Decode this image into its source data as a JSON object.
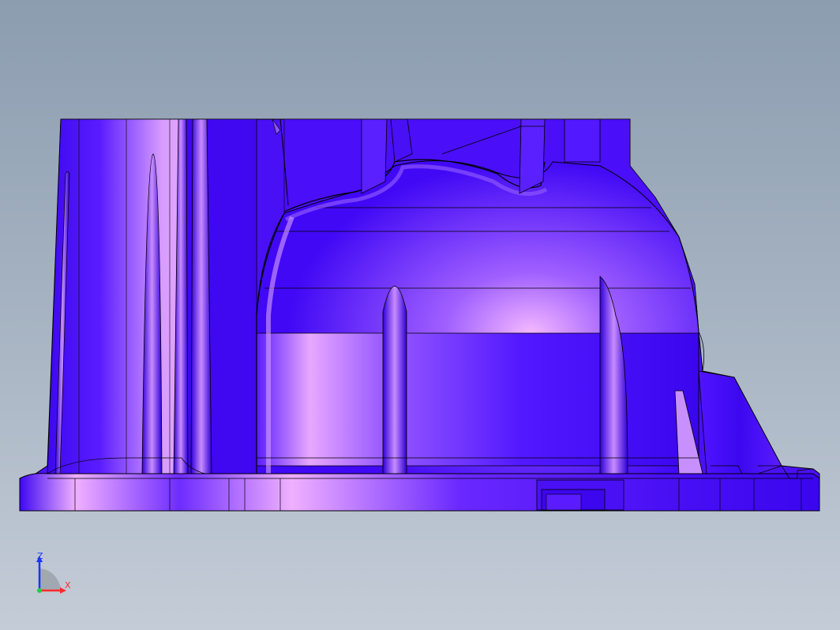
{
  "viewport": {
    "background_top": "#8c9db0",
    "background_bottom": "#c4ccd7",
    "part_color": "#4a10f5",
    "highlight_color": "#f0a8ff",
    "edge_color": "#000000"
  },
  "triad": {
    "z_label": "Z",
    "x_label": "X",
    "z_color": "#1a35ff",
    "x_color": "#ff2a2a",
    "origin_color": "#22cc44"
  }
}
